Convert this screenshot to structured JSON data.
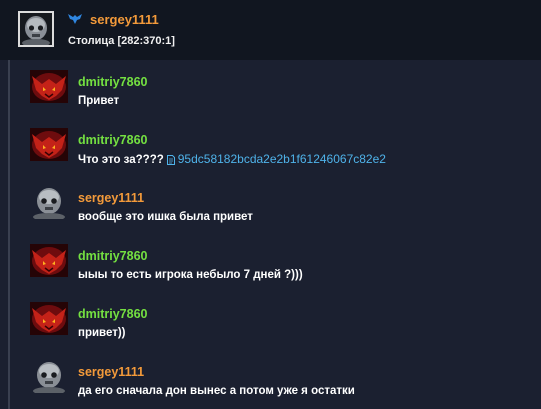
{
  "header": {
    "author": "sergey1111",
    "location": "Столица [282:370:1]",
    "guild_icon": "winged-emblem-icon",
    "avatar": "robot-face-avatar"
  },
  "colors": {
    "background": "#1b2030",
    "header_background": "#111620",
    "author_orange": "#f39a3a",
    "author_green": "#74e041",
    "link": "#4fb3ea",
    "text": "#ffffff"
  },
  "messages": [
    {
      "author": "dmitriy7860",
      "text": "Привет",
      "avatar": "red-demon-avatar"
    },
    {
      "author": "dmitriy7860",
      "text": "Что это за????",
      "link": "95dc58182bcda2e2b1f61246067c82e2",
      "link_icon": "document-icon",
      "avatar": "red-demon-avatar"
    },
    {
      "author": "sergey1111",
      "text": "вообще это ишка была привет",
      "avatar": "robot-face-avatar"
    },
    {
      "author": "dmitriy7860",
      "text": "ыыы то есть игрока небыло 7 дней ?)))",
      "avatar": "red-demon-avatar"
    },
    {
      "author": "dmitriy7860",
      "text": "привет))",
      "avatar": "red-demon-avatar"
    },
    {
      "author": "sergey1111",
      "text": "да его сначала дон вынес а потом уже я остатки",
      "avatar": "robot-face-avatar"
    }
  ]
}
